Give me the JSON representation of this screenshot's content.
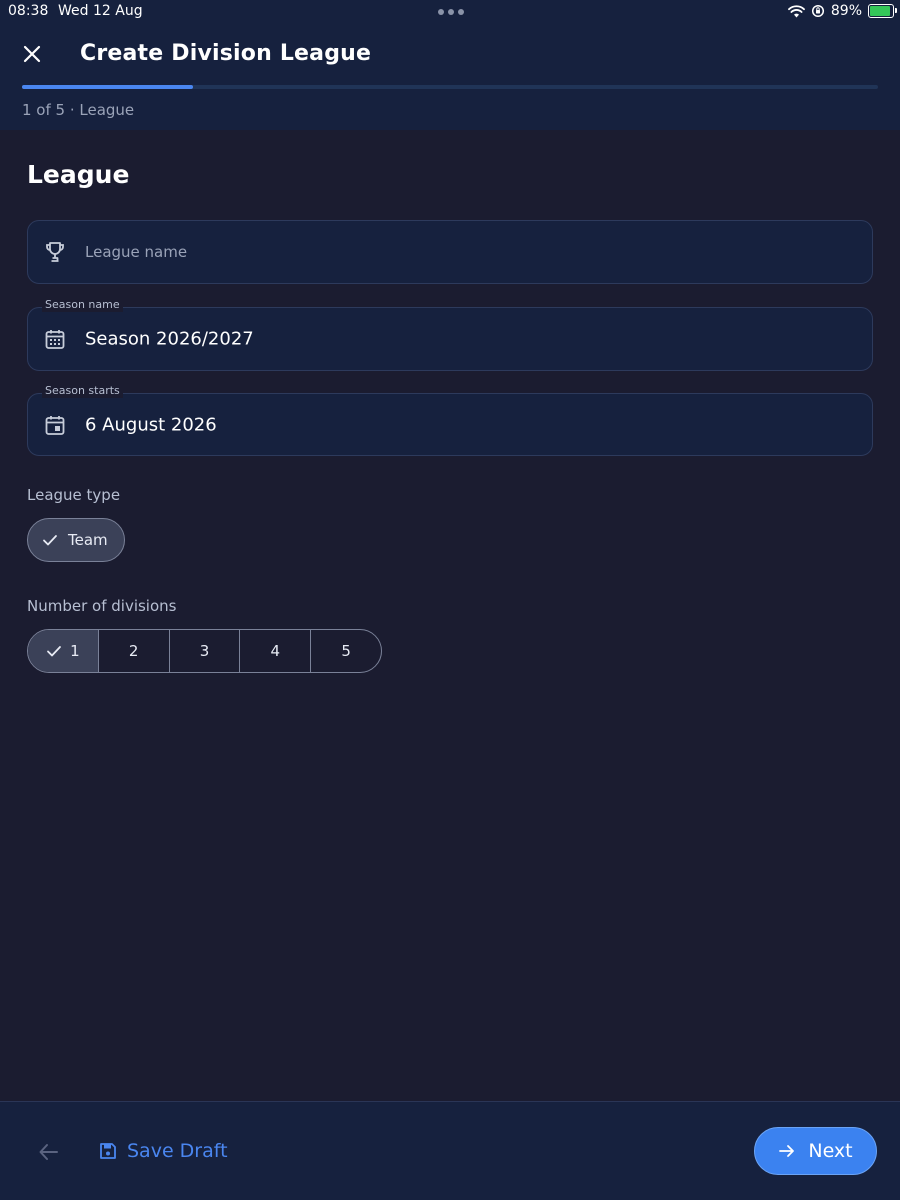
{
  "status_bar": {
    "time": "08:38",
    "date": "Wed 12 Aug",
    "battery": "89%",
    "battery_level": 0.89
  },
  "header": {
    "title": "Create Division League",
    "step_label": "1 of 5 · League",
    "progress": 0.2
  },
  "form": {
    "section_title": "League",
    "league_name": {
      "placeholder": "League name",
      "value": "",
      "icon": "trophy-icon"
    },
    "season_name": {
      "label": "Season name",
      "value": "Season 2026/2027",
      "icon": "calendar-grid-icon"
    },
    "season_starts": {
      "label": "Season starts",
      "value": "6 August 2026",
      "icon": "calendar-event-icon"
    },
    "league_type": {
      "label": "League type",
      "selected": "Team"
    },
    "divisions": {
      "label": "Number of divisions",
      "options": [
        "1",
        "2",
        "3",
        "4",
        "5"
      ],
      "selected": "1"
    }
  },
  "footer": {
    "save_draft_label": "Save Draft",
    "next_label": "Next"
  },
  "colors": {
    "background": "#1b1c30",
    "surface": "#16213e",
    "accent": "#3b82f0",
    "chip_selected": "#3b4158"
  }
}
